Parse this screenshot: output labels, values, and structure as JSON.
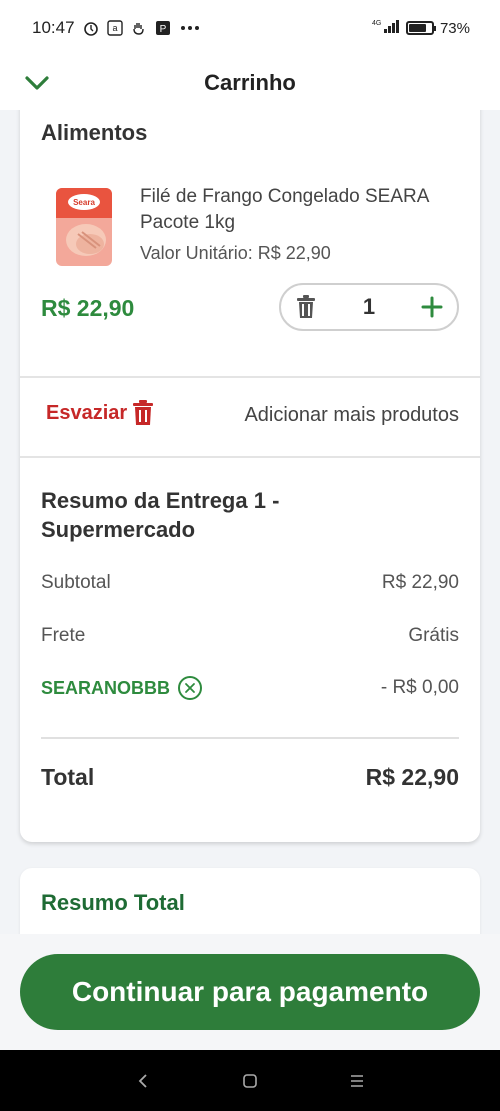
{
  "status": {
    "time": "10:47",
    "network": "4G",
    "battery_pct": "73%",
    "icons": [
      "alarm-icon",
      "amazon-icon",
      "hand-icon",
      "p-app-icon",
      "more-dots-icon"
    ]
  },
  "header": {
    "title": "Carrinho"
  },
  "cart": {
    "section_title": "Alimentos",
    "product": {
      "name": "Filé de Frango Congelado SEARA Pacote 1kg",
      "unit_price": "Valor Unitário: R$ 22,90",
      "price": "R$ 22,90",
      "quantity": "1",
      "image_label": "Seara"
    },
    "empty_label": "Esvaziar",
    "add_more_label": "Adicionar mais produtos"
  },
  "delivery_summary": {
    "title": "Resumo da Entrega 1 - Supermercado",
    "subtotal_label": "Subtotal",
    "subtotal_value": "R$ 22,90",
    "shipping_label": "Frete",
    "shipping_value": "Grátis",
    "coupon_code": "SEARANOBBB",
    "coupon_value": "- R$ 0,00",
    "total_label": "Total",
    "total_value": "R$ 22,90"
  },
  "total_summary": {
    "title": "Resumo Total"
  },
  "cta": {
    "label": "Continuar para pagamento"
  },
  "colors": {
    "green": "#2e8b3e",
    "cta": "#2e7d3a",
    "red": "#c62828"
  }
}
